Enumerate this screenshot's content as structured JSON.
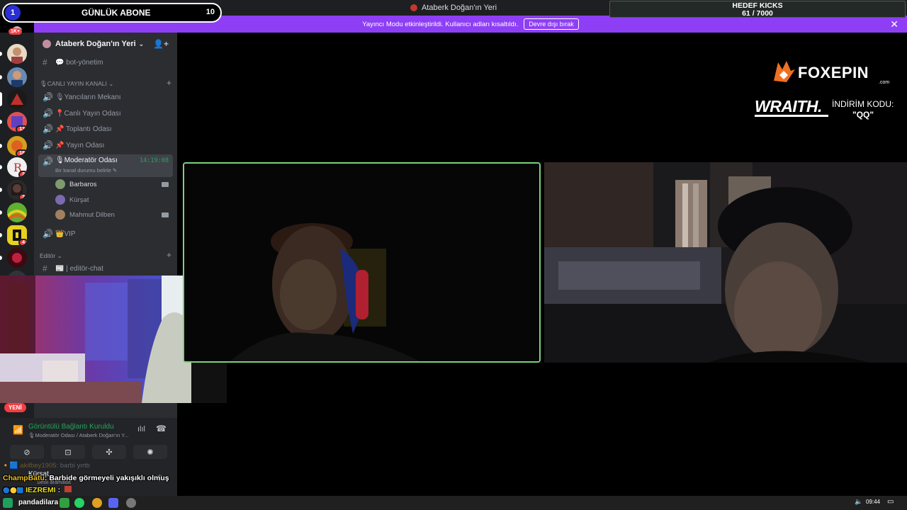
{
  "window": {
    "title": "Ataberk Doğan'ın Yeri"
  },
  "banner": {
    "text": "Yayıncı Modu etkinleştirildi. Kullanıcı adları kısaltıldı.",
    "button": "Devre dışı bırak",
    "close": "✕"
  },
  "overlay": {
    "sub_rank": "1",
    "sub_label": "GÜNLÜK ABONE",
    "sub_count": "10",
    "kicks_label": "HEDEF KICKS",
    "kicks_value": "61 / 7000",
    "rail_top_badge": "1K+",
    "sponsor": {
      "brand": "FOXEPIN",
      "domain": ".com",
      "team": "WRAITH.",
      "code_label": "İNDİRİM KODU:",
      "code_value": "\"QQ\""
    }
  },
  "server": {
    "name": "Ataberk Doğan'ın Yeri"
  },
  "rail_badges": [
    "13",
    "18",
    "2",
    "2",
    "4"
  ],
  "channels": {
    "bot": "💬 bot-yönetim",
    "category_live": "🎙CANLI YAYIN KANALI",
    "yancilar": "🎙Yancıların Mekanı",
    "canli": "📍Canlı Yayın Odası",
    "toplanti": "📌 Toplantı Odası",
    "yayin": "📌 Yayın Odası",
    "moderator": "🎙Moderatör Odası",
    "moderator_timer": "14:19:08",
    "moderator_status": "Bir kanal durumu belirle ✎",
    "vip": "👑VIP",
    "category_editor": "Editör",
    "editor_chat": "📰 | editör-chat"
  },
  "members": [
    {
      "name": "Barbaros",
      "color": "#7e9a6e"
    },
    {
      "name": "Kürşat",
      "color": "#7a6ab0"
    },
    {
      "name": "Mahmut Dilben",
      "color": "#a08060"
    }
  ],
  "voice": {
    "new_badge": "YENİ",
    "status": "Görüntülü Bağlantı Kuruldu",
    "location": "🎙Moderatör Odası / Ataberk Doğan'ın Y..."
  },
  "user": {
    "name": "Kürşat",
    "status": "Sesli aramada"
  },
  "chat": [
    {
      "user": "akifbey1905",
      "text": ": barbi yırttı"
    },
    {
      "user": "ChampBatu",
      "text": ": Barbide görmeyeli yakışıklı olmuş"
    },
    {
      "user": "IEZREMI",
      "text": " :"
    },
    {
      "user": "pandadilara",
      "text": ""
    }
  ],
  "taskbar": {
    "time": "09:44"
  },
  "colors": {
    "accent": "#8e3ff5",
    "online": "#23a55a",
    "speaking_border": "#7dd17b"
  }
}
